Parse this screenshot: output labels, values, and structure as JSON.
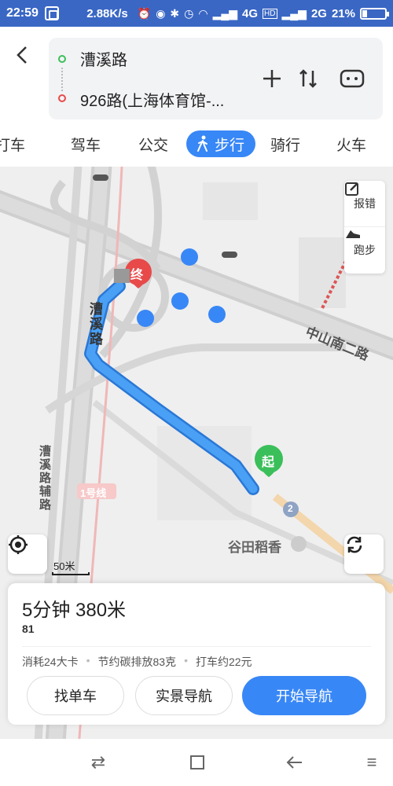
{
  "status_bar": {
    "time": "22:59",
    "net_speed": "2.88K/s",
    "icons": [
      "alarm-icon",
      "location-icon",
      "bluetooth-icon",
      "clock-icon",
      "wifi-icon",
      "signal-icon"
    ],
    "net1": "4G",
    "hd1": "HD",
    "net2": "2G",
    "battery": "21%"
  },
  "header": {
    "start": "漕溪路",
    "end": "926路(上海体育馆-..."
  },
  "tabs": [
    {
      "label": "打车"
    },
    {
      "label": "驾车"
    },
    {
      "label": "公交"
    },
    {
      "label": "步行"
    },
    {
      "label": "骑行"
    },
    {
      "label": "火车"
    }
  ],
  "map": {
    "report_label": "报错",
    "run_label": "跑步",
    "scale": "50米",
    "end_marker": "终",
    "start_marker": "起",
    "road_caoxi": "漕溪路",
    "road_zhongshan": "中山南二路",
    "road_fulu": "漕溪路辅路",
    "line1": "1号线",
    "poi": "谷田稻香",
    "station_num": "2"
  },
  "card": {
    "title": "5分钟  380米",
    "lights": "1",
    "calories": "消耗24大卡",
    "carbon": "节约碳排放83克",
    "taxi": "打车约22元",
    "btn_bike": "找单车",
    "btn_ar": "实景导航",
    "btn_start": "开始导航"
  },
  "colors": {
    "accent": "#3887f6",
    "route": "#3a8fe8",
    "status_bar": "#3a67c4",
    "start": "#3bbf5a",
    "end": "#e84a4a"
  }
}
